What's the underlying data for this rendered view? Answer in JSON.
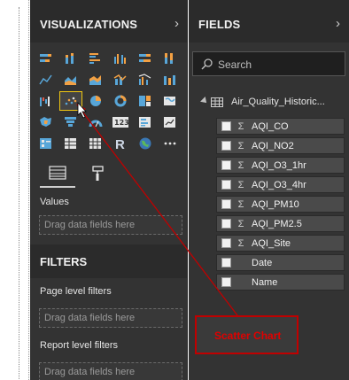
{
  "visualizations": {
    "title": "VISUALIZATIONS",
    "chevron": "›",
    "icons": [
      "stacked-bar-icon",
      "stacked-column-icon",
      "clustered-bar-icon",
      "clustered-column-icon",
      "100-stacked-bar-icon",
      "100-stacked-column-icon",
      "line-chart-icon",
      "area-chart-icon",
      "stacked-area-icon",
      "line-column-icon",
      "line-clustered-icon",
      "ribbon-chart-icon",
      "waterfall-icon",
      "scatter-chart-icon",
      "pie-chart-icon",
      "donut-chart-icon",
      "treemap-icon",
      "map-icon",
      "filled-map-icon",
      "funnel-icon",
      "gauge-icon",
      "card-icon",
      "multi-row-card-icon",
      "kpi-icon",
      "slicer-icon",
      "table-icon",
      "matrix-icon",
      "r-visual-icon",
      "globe-icon",
      "more-icon"
    ],
    "selected_icon": "scatter-chart-icon",
    "values_label": "Values",
    "values_drop": "Drag data fields here",
    "filters_title": "FILTERS",
    "page_filters_label": "Page level filters",
    "page_filters_drop": "Drag data fields here",
    "report_filters_label": "Report level filters",
    "report_filters_drop": "Drag data fields here"
  },
  "fields": {
    "title": "FIELDS",
    "chevron": "›",
    "search_placeholder": "Search",
    "table_name": "Air_Quality_Historic...",
    "items": [
      {
        "label": "AQI_CO",
        "sigma": "Σ"
      },
      {
        "label": "AQI_NO2",
        "sigma": "Σ"
      },
      {
        "label": "AQI_O3_1hr",
        "sigma": "Σ"
      },
      {
        "label": "AQI_O3_4hr",
        "sigma": "Σ"
      },
      {
        "label": "AQI_PM10",
        "sigma": "Σ"
      },
      {
        "label": "AQI_PM2.5",
        "sigma": "Σ"
      },
      {
        "label": "AQI_Site",
        "sigma": "Σ"
      },
      {
        "label": "Date",
        "sigma": ""
      },
      {
        "label": "Name",
        "sigma": ""
      }
    ]
  },
  "annotation": {
    "text": "Scatter Chart",
    "color": "#c00000"
  },
  "colors": {
    "pane_bg": "#333333",
    "header_bg": "#2b2b2b",
    "accent_yellow": "#f2c811",
    "field_bg": "#4a4a4a"
  }
}
